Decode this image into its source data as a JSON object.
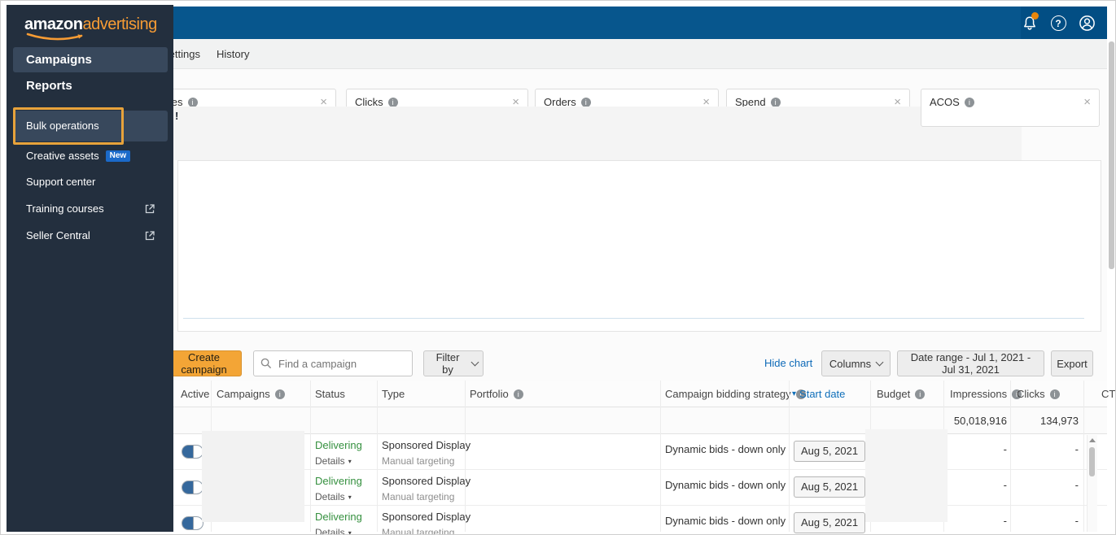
{
  "sidebar": {
    "logo_amazon": "amazon",
    "logo_advertising": "advertising",
    "items": [
      {
        "label": "Campaigns"
      },
      {
        "label": "Reports"
      },
      {
        "label": "Bulk operations"
      },
      {
        "label": "Creative assets",
        "badge": "New"
      },
      {
        "label": "Support center"
      },
      {
        "label": "Training courses"
      },
      {
        "label": "Seller Central"
      }
    ]
  },
  "topbar": {
    "icons": [
      "notifications-bell",
      "help",
      "account"
    ],
    "notification_dot_color": "#e8860c",
    "bar_color": "#07568d"
  },
  "tabs": {
    "items": [
      {
        "label": "Settings"
      },
      {
        "label": "History"
      }
    ]
  },
  "metric_cards": {
    "cards": [
      {
        "label": "Sales"
      },
      {
        "label": "Clicks"
      },
      {
        "label": "Orders"
      },
      {
        "label": "Spend"
      },
      {
        "label": "ACOS"
      }
    ]
  },
  "misc": {
    "overlay_partial_text": "!"
  },
  "toolbar": {
    "create_campaign": "Create campaign",
    "search_placeholder": "Find a campaign",
    "filter_by": "Filter by",
    "hide_chart": "Hide chart",
    "columns": "Columns",
    "date_range": "Date range - Jul 1, 2021 - Jul 31, 2021",
    "export": "Export"
  },
  "table": {
    "columns": [
      {
        "label": "Active"
      },
      {
        "label": "Campaigns",
        "info": true
      },
      {
        "label": "Status"
      },
      {
        "label": "Type"
      },
      {
        "label": "Portfolio",
        "info": true
      },
      {
        "label": "Campaign bidding strategy",
        "info": true
      },
      {
        "label": "Start date",
        "sorted": "desc"
      },
      {
        "label": "Budget",
        "info": true
      },
      {
        "label": "Impressions",
        "info": true
      },
      {
        "label": "Clicks",
        "info": true
      },
      {
        "label": "CTR"
      }
    ],
    "totals": {
      "impressions": "50,018,916",
      "clicks": "134,973"
    },
    "rows": [
      {
        "active": true,
        "status": "Delivering",
        "details_label": "Details",
        "type": "Sponsored Display",
        "targeting": "Manual targeting",
        "bidding_strategy": "Dynamic bids - down only",
        "start_date": "Aug 5, 2021",
        "impressions": "-",
        "clicks": "-"
      },
      {
        "active": true,
        "status": "Delivering",
        "details_label": "Details",
        "type": "Sponsored Display",
        "targeting": "Manual targeting",
        "bidding_strategy": "Dynamic bids - down only",
        "start_date": "Aug 5, 2021",
        "impressions": "-",
        "clicks": "-"
      },
      {
        "active": true,
        "status": "Delivering",
        "details_label": "Details",
        "type": "Sponsored Display",
        "targeting": "Manual targeting",
        "bidding_strategy": "Dynamic bids - down only",
        "start_date": "Aug 5, 2021",
        "impressions": "-",
        "clicks": "-"
      }
    ]
  },
  "icons": {
    "close": "×",
    "info": "i",
    "sort_desc": "▾",
    "details_caret": "▾"
  },
  "colors": {
    "sidebar_bg": "#232f3e",
    "sidebar_selected_bg": "#38485c",
    "highlight_box": "#e8a33b",
    "navbar_blue": "#07568d",
    "link_blue": "#0f6bb8",
    "delivering_green": "#35903f",
    "create_button_orange": "#f3a536",
    "toggle_blue": "#35689c",
    "badge_blue": "#1b6ac9"
  }
}
